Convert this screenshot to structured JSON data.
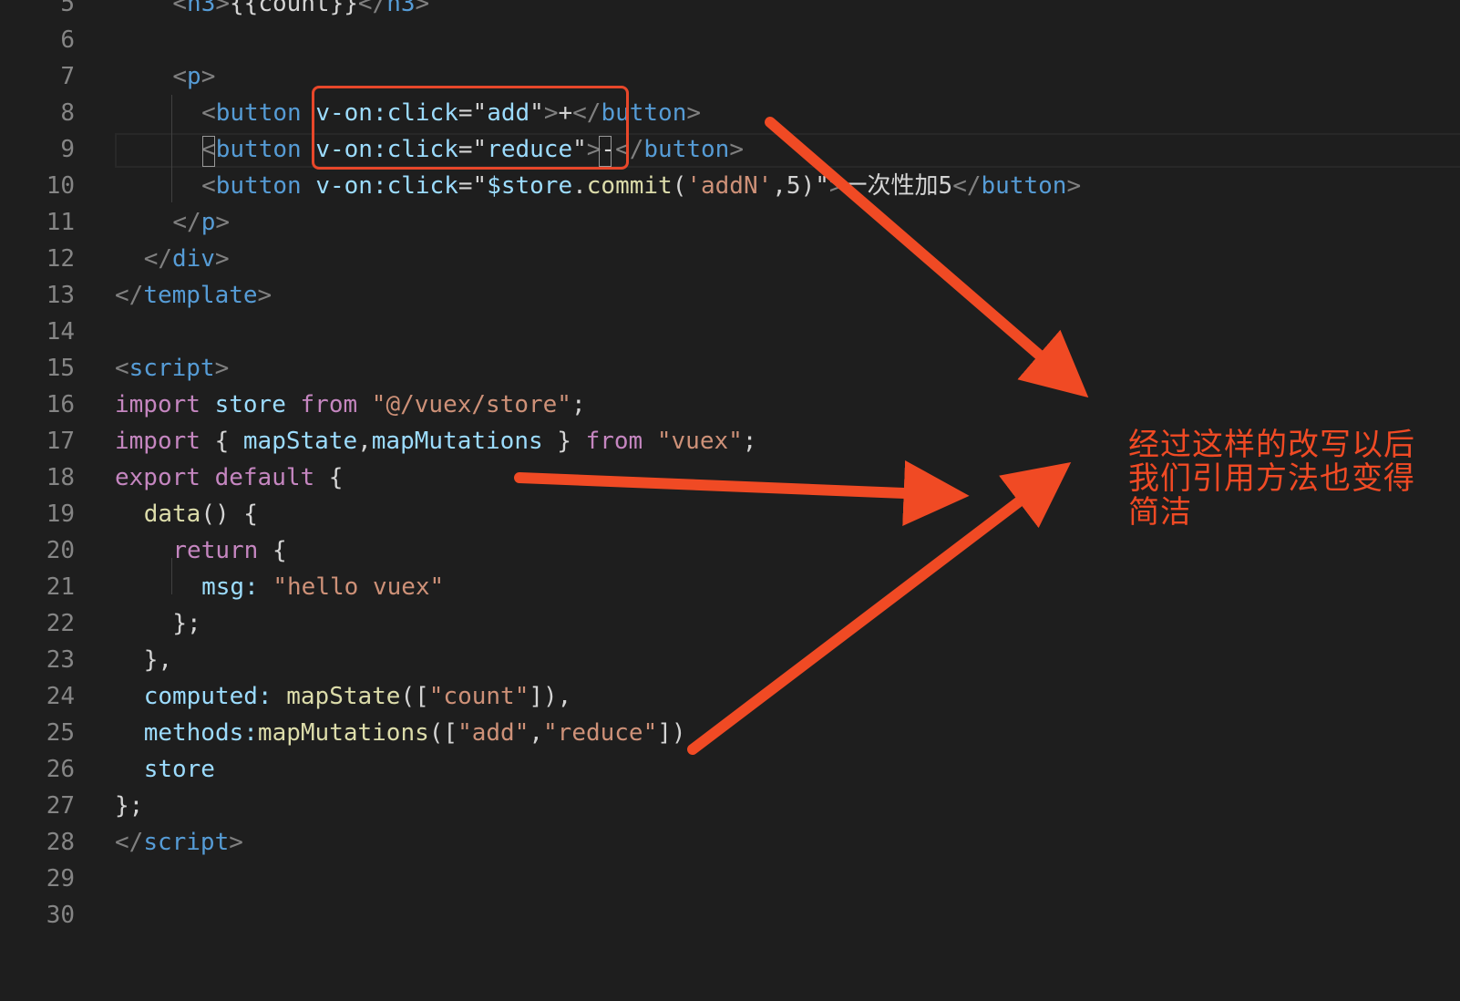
{
  "colors": {
    "background": "#1e1e1e",
    "annotation": "#f04a24",
    "highlight_box": "#e8472a"
  },
  "editor": {
    "lines": [
      {
        "n": "5",
        "tokens": [
          {
            "t": "<",
            "c": "tag"
          },
          {
            "t": "h3",
            "c": "tagname"
          },
          {
            "t": ">",
            "c": "tag"
          },
          {
            "t": "{{count}}",
            "c": "text"
          },
          {
            "t": "</",
            "c": "tag"
          },
          {
            "t": "h3",
            "c": "tagname"
          },
          {
            "t": ">",
            "c": "tag"
          }
        ],
        "indent": 4
      },
      {
        "n": "6",
        "tokens": [],
        "indent": 0
      },
      {
        "n": "7",
        "tokens": [
          {
            "t": "<",
            "c": "tag"
          },
          {
            "t": "p",
            "c": "tagname"
          },
          {
            "t": ">",
            "c": "tag"
          }
        ],
        "indent": 4
      },
      {
        "n": "8",
        "tokens": [
          {
            "t": "<",
            "c": "tag"
          },
          {
            "t": "button",
            "c": "tagname"
          },
          {
            "t": " ",
            "c": "text"
          },
          {
            "t": "v-on:click",
            "c": "attr"
          },
          {
            "t": "=",
            "c": "text"
          },
          {
            "t": "\"",
            "c": "text"
          },
          {
            "t": "add",
            "c": "attr"
          },
          {
            "t": "\"",
            "c": "text"
          },
          {
            "t": ">",
            "c": "tag"
          },
          {
            "t": "+",
            "c": "text"
          },
          {
            "t": "</",
            "c": "tag"
          },
          {
            "t": "button",
            "c": "tagname"
          },
          {
            "t": ">",
            "c": "tag"
          }
        ],
        "indent": 6
      },
      {
        "n": "9",
        "tokens": [
          {
            "t": "<",
            "c": "tag"
          },
          {
            "t": "button",
            "c": "tagname"
          },
          {
            "t": " ",
            "c": "text"
          },
          {
            "t": "v-on:click",
            "c": "attr"
          },
          {
            "t": "=",
            "c": "text"
          },
          {
            "t": "\"",
            "c": "text"
          },
          {
            "t": "reduce",
            "c": "attr"
          },
          {
            "t": "\"",
            "c": "text"
          },
          {
            "t": ">",
            "c": "tag"
          },
          {
            "t": "-",
            "c": "text"
          },
          {
            "t": "</",
            "c": "tag"
          },
          {
            "t": "button",
            "c": "tagname"
          },
          {
            "t": ">",
            "c": "tag"
          }
        ],
        "indent": 6
      },
      {
        "n": "10",
        "tokens": [
          {
            "t": "<",
            "c": "tag"
          },
          {
            "t": "button",
            "c": "tagname"
          },
          {
            "t": " ",
            "c": "text"
          },
          {
            "t": "v-on:click",
            "c": "attr"
          },
          {
            "t": "=",
            "c": "text"
          },
          {
            "t": "\"",
            "c": "text"
          },
          {
            "t": "$store",
            "c": "attr"
          },
          {
            "t": ".",
            "c": "text"
          },
          {
            "t": "commit",
            "c": "fn"
          },
          {
            "t": "(",
            "c": "text"
          },
          {
            "t": "'addN'",
            "c": "str"
          },
          {
            "t": ",",
            "c": "text"
          },
          {
            "t": "5",
            "c": "text"
          },
          {
            "t": ")",
            "c": "text"
          },
          {
            "t": "\"",
            "c": "text"
          },
          {
            "t": ">",
            "c": "tag"
          },
          {
            "t": "一次性加5",
            "c": "text"
          },
          {
            "t": "</",
            "c": "tag"
          },
          {
            "t": "button",
            "c": "tagname"
          },
          {
            "t": ">",
            "c": "tag"
          }
        ],
        "indent": 6
      },
      {
        "n": "11",
        "tokens": [
          {
            "t": "</",
            "c": "tag"
          },
          {
            "t": "p",
            "c": "tagname"
          },
          {
            "t": ">",
            "c": "tag"
          }
        ],
        "indent": 4
      },
      {
        "n": "12",
        "tokens": [
          {
            "t": "</",
            "c": "tag"
          },
          {
            "t": "div",
            "c": "tagname"
          },
          {
            "t": ">",
            "c": "tag"
          }
        ],
        "indent": 2
      },
      {
        "n": "13",
        "tokens": [
          {
            "t": "</",
            "c": "tag"
          },
          {
            "t": "template",
            "c": "tagname"
          },
          {
            "t": ">",
            "c": "tag"
          }
        ],
        "indent": 0
      },
      {
        "n": "14",
        "tokens": [],
        "indent": 0
      },
      {
        "n": "15",
        "tokens": [
          {
            "t": "<",
            "c": "tag"
          },
          {
            "t": "script",
            "c": "tagname"
          },
          {
            "t": ">",
            "c": "tag"
          }
        ],
        "indent": 0
      },
      {
        "n": "16",
        "tokens": [
          {
            "t": "import",
            "c": "kw"
          },
          {
            "t": " ",
            "c": "text"
          },
          {
            "t": "store",
            "c": "var"
          },
          {
            "t": " ",
            "c": "text"
          },
          {
            "t": "from",
            "c": "kw"
          },
          {
            "t": " ",
            "c": "text"
          },
          {
            "t": "\"@/vuex/store\"",
            "c": "str"
          },
          {
            "t": ";",
            "c": "text"
          }
        ],
        "indent": 0
      },
      {
        "n": "17",
        "tokens": [
          {
            "t": "import",
            "c": "kw"
          },
          {
            "t": " { ",
            "c": "text"
          },
          {
            "t": "mapState",
            "c": "var"
          },
          {
            "t": ",",
            "c": "text"
          },
          {
            "t": "mapMutations",
            "c": "var"
          },
          {
            "t": " } ",
            "c": "text"
          },
          {
            "t": "from",
            "c": "kw"
          },
          {
            "t": " ",
            "c": "text"
          },
          {
            "t": "\"vuex\"",
            "c": "str"
          },
          {
            "t": ";",
            "c": "text"
          }
        ],
        "indent": 0
      },
      {
        "n": "18",
        "tokens": [
          {
            "t": "export",
            "c": "kw"
          },
          {
            "t": " ",
            "c": "text"
          },
          {
            "t": "default",
            "c": "kw"
          },
          {
            "t": " {",
            "c": "text"
          }
        ],
        "indent": 0
      },
      {
        "n": "19",
        "tokens": [
          {
            "t": "data",
            "c": "fn"
          },
          {
            "t": "() {",
            "c": "text"
          }
        ],
        "indent": 2
      },
      {
        "n": "20",
        "tokens": [
          {
            "t": "return",
            "c": "kw"
          },
          {
            "t": " {",
            "c": "text"
          }
        ],
        "indent": 4
      },
      {
        "n": "21",
        "tokens": [
          {
            "t": "msg",
            "c": "var"
          },
          {
            "t": ":",
            "c": "var"
          },
          {
            "t": " ",
            "c": "text"
          },
          {
            "t": "\"hello vuex\"",
            "c": "str"
          }
        ],
        "indent": 6
      },
      {
        "n": "22",
        "tokens": [
          {
            "t": "};",
            "c": "text"
          }
        ],
        "indent": 4
      },
      {
        "n": "23",
        "tokens": [
          {
            "t": "},",
            "c": "text"
          }
        ],
        "indent": 2
      },
      {
        "n": "24",
        "tokens": [
          {
            "t": "computed",
            "c": "var"
          },
          {
            "t": ":",
            "c": "var"
          },
          {
            "t": " ",
            "c": "text"
          },
          {
            "t": "mapState",
            "c": "fn"
          },
          {
            "t": "([",
            "c": "text"
          },
          {
            "t": "\"count\"",
            "c": "str"
          },
          {
            "t": "]),",
            "c": "text"
          }
        ],
        "indent": 2
      },
      {
        "n": "25",
        "tokens": [
          {
            "t": "methods",
            "c": "var"
          },
          {
            "t": ":",
            "c": "var"
          },
          {
            "t": "mapMutations",
            "c": "fn"
          },
          {
            "t": "([",
            "c": "text"
          },
          {
            "t": "\"add\"",
            "c": "str"
          },
          {
            "t": ",",
            "c": "text"
          },
          {
            "t": "\"reduce\"",
            "c": "str"
          },
          {
            "t": "])",
            "c": "text"
          }
        ],
        "indent": 2
      },
      {
        "n": "26",
        "tokens": [
          {
            "t": "store",
            "c": "var"
          }
        ],
        "indent": 2
      },
      {
        "n": "27",
        "tokens": [
          {
            "t": "};",
            "c": "text"
          }
        ],
        "indent": 0
      },
      {
        "n": "28",
        "tokens": [
          {
            "t": "</",
            "c": "tag"
          },
          {
            "t": "script",
            "c": "tagname"
          },
          {
            "t": ">",
            "c": "tag"
          }
        ],
        "indent": 0
      },
      {
        "n": "29",
        "tokens": [],
        "indent": 0
      },
      {
        "n": "30",
        "tokens": [],
        "indent": 0
      }
    ]
  },
  "annotation": {
    "line1": "经过这样的改写以后",
    "line2": "我们引用方法也变得",
    "line3": "简洁"
  }
}
